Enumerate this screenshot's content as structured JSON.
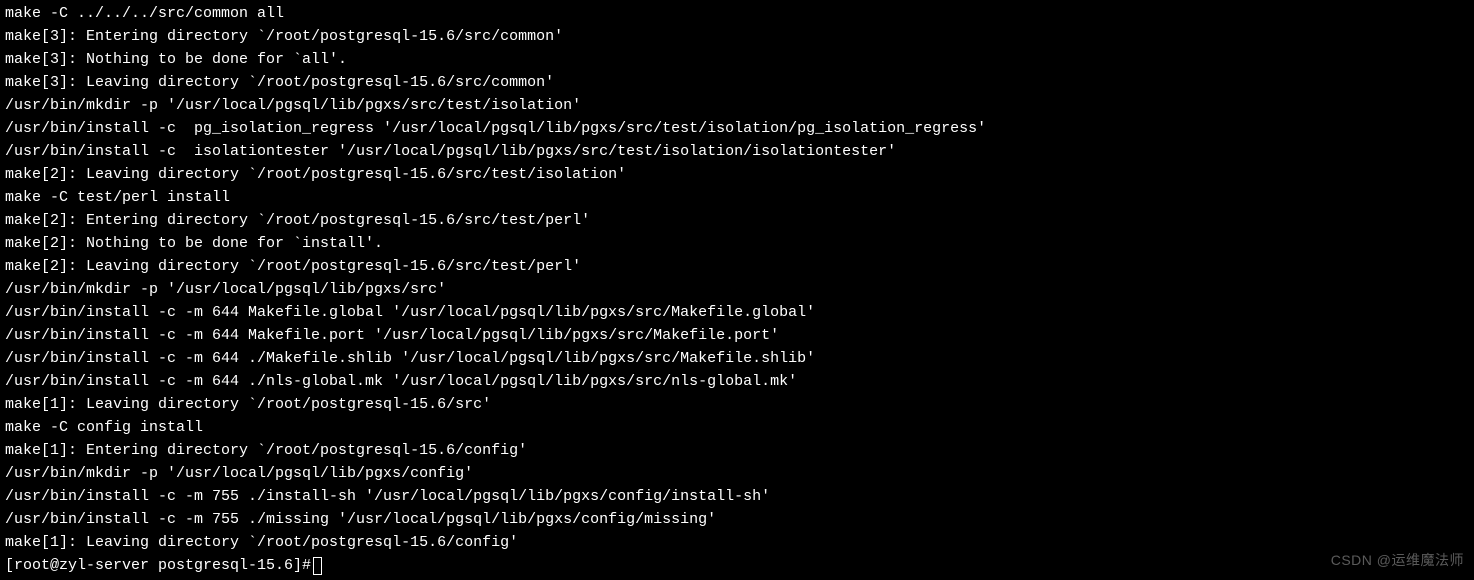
{
  "terminal": {
    "lines": [
      "make -C ../../../src/common all",
      "make[3]: Entering directory `/root/postgresql-15.6/src/common'",
      "make[3]: Nothing to be done for `all'.",
      "make[3]: Leaving directory `/root/postgresql-15.6/src/common'",
      "/usr/bin/mkdir -p '/usr/local/pgsql/lib/pgxs/src/test/isolation'",
      "/usr/bin/install -c  pg_isolation_regress '/usr/local/pgsql/lib/pgxs/src/test/isolation/pg_isolation_regress'",
      "/usr/bin/install -c  isolationtester '/usr/local/pgsql/lib/pgxs/src/test/isolation/isolationtester'",
      "make[2]: Leaving directory `/root/postgresql-15.6/src/test/isolation'",
      "make -C test/perl install",
      "make[2]: Entering directory `/root/postgresql-15.6/src/test/perl'",
      "make[2]: Nothing to be done for `install'.",
      "make[2]: Leaving directory `/root/postgresql-15.6/src/test/perl'",
      "/usr/bin/mkdir -p '/usr/local/pgsql/lib/pgxs/src'",
      "/usr/bin/install -c -m 644 Makefile.global '/usr/local/pgsql/lib/pgxs/src/Makefile.global'",
      "/usr/bin/install -c -m 644 Makefile.port '/usr/local/pgsql/lib/pgxs/src/Makefile.port'",
      "/usr/bin/install -c -m 644 ./Makefile.shlib '/usr/local/pgsql/lib/pgxs/src/Makefile.shlib'",
      "/usr/bin/install -c -m 644 ./nls-global.mk '/usr/local/pgsql/lib/pgxs/src/nls-global.mk'",
      "make[1]: Leaving directory `/root/postgresql-15.6/src'",
      "make -C config install",
      "make[1]: Entering directory `/root/postgresql-15.6/config'",
      "/usr/bin/mkdir -p '/usr/local/pgsql/lib/pgxs/config'",
      "/usr/bin/install -c -m 755 ./install-sh '/usr/local/pgsql/lib/pgxs/config/install-sh'",
      "/usr/bin/install -c -m 755 ./missing '/usr/local/pgsql/lib/pgxs/config/missing'",
      "make[1]: Leaving directory `/root/postgresql-15.6/config'"
    ],
    "prompt": "[root@zyl-server postgresql-15.6]# "
  },
  "watermark": "CSDN @运维魔法师"
}
